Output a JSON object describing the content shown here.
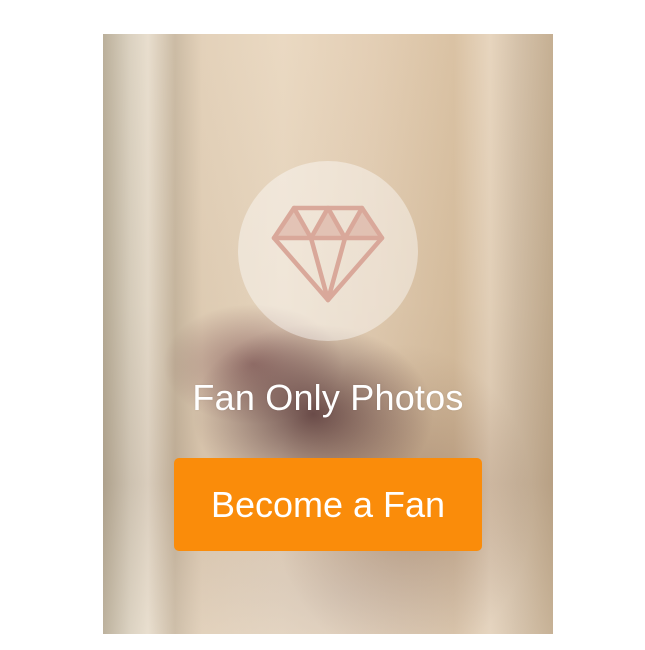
{
  "locked_content": {
    "caption": "Fan Only Photos",
    "cta_label": "Become a Fan",
    "icon": "diamond-icon"
  },
  "colors": {
    "cta_background": "#fa8c0a",
    "text": "#ffffff",
    "icon_stroke": "#d9a89a"
  }
}
